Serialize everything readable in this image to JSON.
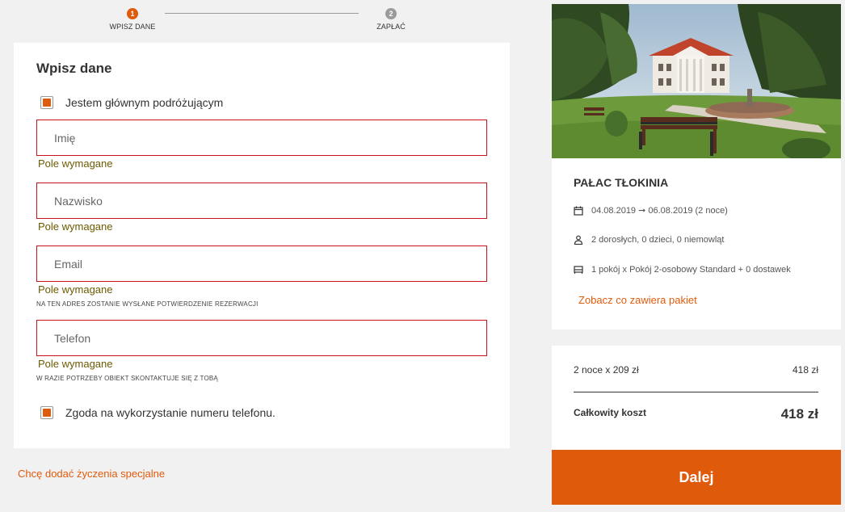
{
  "stepper": {
    "steps": [
      {
        "number": "1",
        "label": "WPISZ DANE"
      },
      {
        "number": "2",
        "label": "ZAPŁAĆ"
      }
    ]
  },
  "form": {
    "title": "Wpisz dane",
    "main_traveler_label": "Jestem głównym podróżującym",
    "first_name": {
      "placeholder": "Imię",
      "error": "Pole wymagane"
    },
    "last_name": {
      "placeholder": "Nazwisko",
      "error": "Pole wymagane"
    },
    "email": {
      "placeholder": "Email",
      "error": "Pole wymagane",
      "hint": "NA TEN ADRES ZOSTANIE WYSŁANE POTWIERDZENIE REZERWACJI"
    },
    "phone": {
      "placeholder": "Telefon",
      "error": "Pole wymagane",
      "hint": "W RAZIE POTRZEBY OBIEKT SKONTAKTUJE SIĘ Z TOBĄ"
    },
    "phone_consent_label": "Zgoda na wykorzystanie numeru telefonu."
  },
  "special_requests_link": "Chcę dodać życzenia specjalne",
  "summary": {
    "hotel_name": "PAŁAC TŁOKINIA",
    "dates": "04.08.2019 ➞ 06.08.2019 (2 noce)",
    "guests": "2 dorosłych, 0 dzieci, 0 niemowląt",
    "room": "1 pokój x Pokój 2-osobowy Standard + 0 dostawek",
    "package_link": "Zobacz co zawiera pakiet",
    "icons": [
      "calendar-icon",
      "person-icon",
      "bed-icon"
    ]
  },
  "price": {
    "line_label": "2 noce x 209 zł",
    "line_value": "418 zł",
    "total_label": "Całkowity koszt",
    "total_value": "418 zł"
  },
  "next_button": "Dalej",
  "colors": {
    "accent": "#e05a0c",
    "error_border": "#c8111a",
    "error_text": "#6b5a00",
    "background": "#f1f1f1"
  }
}
